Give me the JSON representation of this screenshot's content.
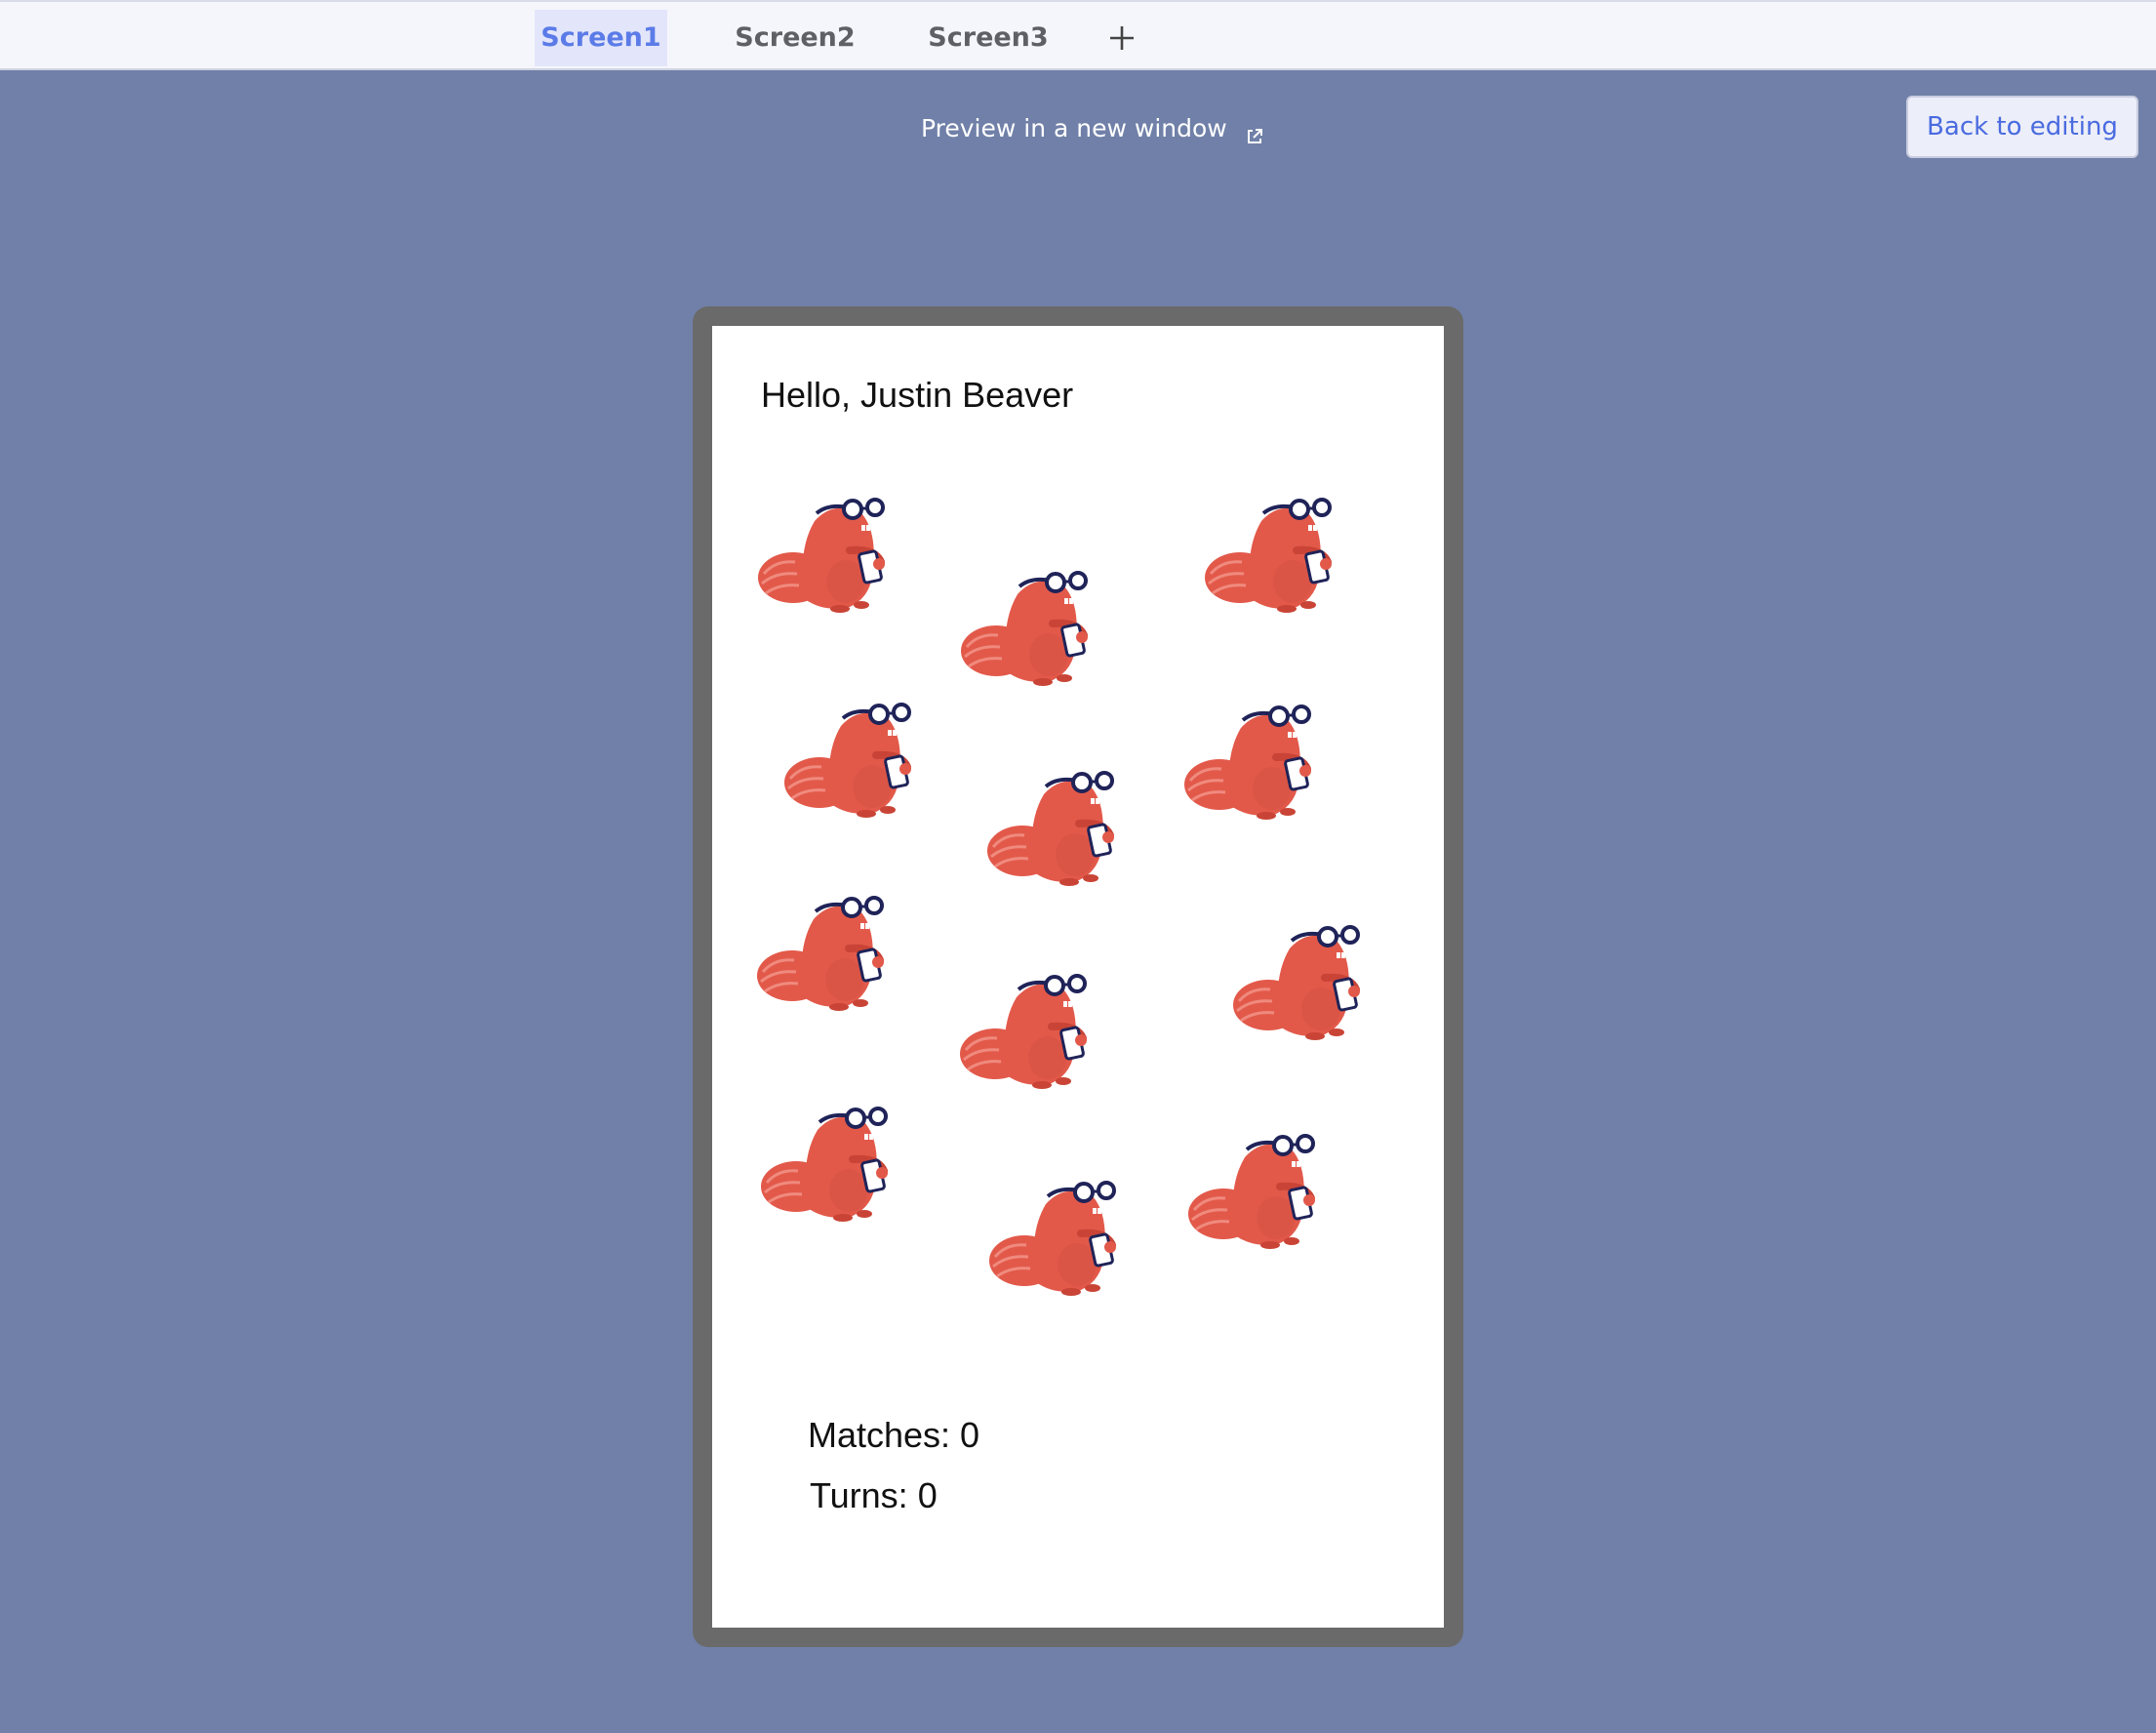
{
  "tabs": [
    {
      "label": "Screen1",
      "active": true
    },
    {
      "label": "Screen2",
      "active": false
    },
    {
      "label": "Screen3",
      "active": false
    }
  ],
  "preview": {
    "label": "Preview in a new window",
    "icon": "external-link-icon"
  },
  "back_button": {
    "label": "Back to editing"
  },
  "app": {
    "greeting": "Hello, Justin Beaver",
    "matches_label": "Matches: 0",
    "turns_label": "Turns: 0",
    "cards_count": 12,
    "card_icon": "beaver-with-glasses-icon"
  },
  "colors": {
    "background": "#7080a8",
    "accent": "#5b7be8",
    "beaver": "#e2594a",
    "phone_frame": "#6a6a6a"
  }
}
